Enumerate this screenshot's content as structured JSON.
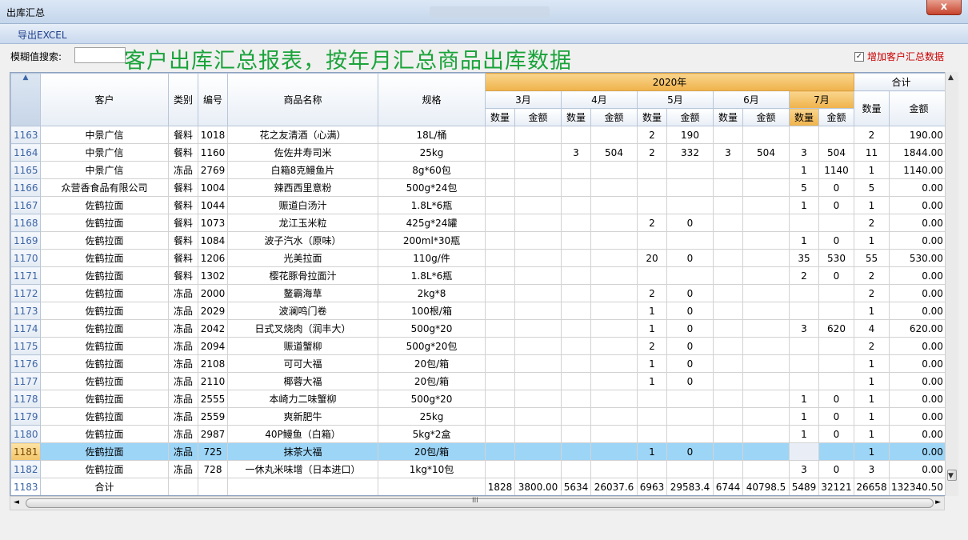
{
  "window": {
    "title": "出库汇总",
    "close_label": "x"
  },
  "toolbar": {
    "export_label": "导出EXCEL"
  },
  "search": {
    "label": "模糊值搜索:",
    "value": ""
  },
  "banner": "客户出库汇总报表，按年月汇总商品出库数据",
  "option": {
    "label": "增加客户汇总数据",
    "checked": "✓"
  },
  "headers": {
    "customer": "客户",
    "category": "类别",
    "code": "编号",
    "product": "商品名称",
    "spec": "规格",
    "year": "2020年",
    "total_group": "合计",
    "months": [
      "3月",
      "4月",
      "5月",
      "6月",
      "7月"
    ],
    "qty": "数量",
    "amt": "金额"
  },
  "rows": [
    {
      "rn": "1163",
      "customer": "中景广信",
      "cat": "餐料",
      "code": "1018",
      "name": "花之友清酒（心满）",
      "spec": "18L/桶",
      "m": [
        [
          "",
          ""
        ],
        [
          "",
          ""
        ],
        [
          "2",
          "190"
        ],
        [
          "",
          ""
        ],
        [
          "",
          ""
        ]
      ],
      "tq": "2",
      "ta": "190.00"
    },
    {
      "rn": "1164",
      "customer": "中景广信",
      "cat": "餐料",
      "code": "1160",
      "name": "佐佐井寿司米",
      "spec": "25kg",
      "m": [
        [
          "",
          ""
        ],
        [
          "3",
          "504"
        ],
        [
          "2",
          "332"
        ],
        [
          "3",
          "504"
        ],
        [
          "3",
          "504"
        ]
      ],
      "tq": "11",
      "ta": "1844.00"
    },
    {
      "rn": "1165",
      "customer": "中景广信",
      "cat": "冻品",
      "code": "2769",
      "name": "白箱8克鳗鱼片",
      "spec": "8g*60包",
      "m": [
        [
          "",
          ""
        ],
        [
          "",
          ""
        ],
        [
          "",
          ""
        ],
        [
          "",
          ""
        ],
        [
          "1",
          "1140"
        ]
      ],
      "tq": "1",
      "ta": "1140.00"
    },
    {
      "rn": "1166",
      "customer": "众营香食品有限公司",
      "cat": "餐料",
      "code": "1004",
      "name": "辣西西里意粉",
      "spec": "500g*24包",
      "m": [
        [
          "",
          ""
        ],
        [
          "",
          ""
        ],
        [
          "",
          ""
        ],
        [
          "",
          ""
        ],
        [
          "5",
          "0"
        ]
      ],
      "tq": "5",
      "ta": "0.00"
    },
    {
      "rn": "1167",
      "customer": "佐鹤拉面",
      "cat": "餐料",
      "code": "1044",
      "name": "赈道白汤汁",
      "spec": "1.8L*6瓶",
      "m": [
        [
          "",
          ""
        ],
        [
          "",
          ""
        ],
        [
          "",
          ""
        ],
        [
          "",
          ""
        ],
        [
          "1",
          "0"
        ]
      ],
      "tq": "1",
      "ta": "0.00"
    },
    {
      "rn": "1168",
      "customer": "佐鹤拉面",
      "cat": "餐料",
      "code": "1073",
      "name": "龙江玉米粒",
      "spec": "425g*24罐",
      "m": [
        [
          "",
          ""
        ],
        [
          "",
          ""
        ],
        [
          "2",
          "0"
        ],
        [
          "",
          ""
        ],
        [
          "",
          ""
        ]
      ],
      "tq": "2",
      "ta": "0.00"
    },
    {
      "rn": "1169",
      "customer": "佐鹤拉面",
      "cat": "餐料",
      "code": "1084",
      "name": "波子汽水（原味）",
      "spec": "200ml*30瓶",
      "m": [
        [
          "",
          ""
        ],
        [
          "",
          ""
        ],
        [
          "",
          ""
        ],
        [
          "",
          ""
        ],
        [
          "1",
          "0"
        ]
      ],
      "tq": "1",
      "ta": "0.00"
    },
    {
      "rn": "1170",
      "customer": "佐鹤拉面",
      "cat": "餐料",
      "code": "1206",
      "name": "光美拉面",
      "spec": "110g/件",
      "m": [
        [
          "",
          ""
        ],
        [
          "",
          ""
        ],
        [
          "20",
          "0"
        ],
        [
          "",
          ""
        ],
        [
          "35",
          "530"
        ]
      ],
      "tq": "55",
      "ta": "530.00"
    },
    {
      "rn": "1171",
      "customer": "佐鹤拉面",
      "cat": "餐料",
      "code": "1302",
      "name": "樱花豚骨拉面汁",
      "spec": "1.8L*6瓶",
      "m": [
        [
          "",
          ""
        ],
        [
          "",
          ""
        ],
        [
          "",
          ""
        ],
        [
          "",
          ""
        ],
        [
          "2",
          "0"
        ]
      ],
      "tq": "2",
      "ta": "0.00"
    },
    {
      "rn": "1172",
      "customer": "佐鹤拉面",
      "cat": "冻品",
      "code": "2000",
      "name": "鳌霸海草",
      "spec": "2kg*8",
      "m": [
        [
          "",
          ""
        ],
        [
          "",
          ""
        ],
        [
          "2",
          "0"
        ],
        [
          "",
          ""
        ],
        [
          "",
          ""
        ]
      ],
      "tq": "2",
      "ta": "0.00"
    },
    {
      "rn": "1173",
      "customer": "佐鹤拉面",
      "cat": "冻品",
      "code": "2029",
      "name": "波澜鸣门卷",
      "spec": "100根/箱",
      "m": [
        [
          "",
          ""
        ],
        [
          "",
          ""
        ],
        [
          "1",
          "0"
        ],
        [
          "",
          ""
        ],
        [
          "",
          ""
        ]
      ],
      "tq": "1",
      "ta": "0.00"
    },
    {
      "rn": "1174",
      "customer": "佐鹤拉面",
      "cat": "冻品",
      "code": "2042",
      "name": "日式叉烧肉（润丰大）",
      "spec": "500g*20",
      "m": [
        [
          "",
          ""
        ],
        [
          "",
          ""
        ],
        [
          "1",
          "0"
        ],
        [
          "",
          ""
        ],
        [
          "3",
          "620"
        ]
      ],
      "tq": "4",
      "ta": "620.00"
    },
    {
      "rn": "1175",
      "customer": "佐鹤拉面",
      "cat": "冻品",
      "code": "2094",
      "name": "赈道蟹柳",
      "spec": "500g*20包",
      "m": [
        [
          "",
          ""
        ],
        [
          "",
          ""
        ],
        [
          "2",
          "0"
        ],
        [
          "",
          ""
        ],
        [
          "",
          ""
        ]
      ],
      "tq": "2",
      "ta": "0.00"
    },
    {
      "rn": "1176",
      "customer": "佐鹤拉面",
      "cat": "冻品",
      "code": "2108",
      "name": "可可大福",
      "spec": "20包/箱",
      "m": [
        [
          "",
          ""
        ],
        [
          "",
          ""
        ],
        [
          "1",
          "0"
        ],
        [
          "",
          ""
        ],
        [
          "",
          ""
        ]
      ],
      "tq": "1",
      "ta": "0.00"
    },
    {
      "rn": "1177",
      "customer": "佐鹤拉面",
      "cat": "冻品",
      "code": "2110",
      "name": "椰蓉大福",
      "spec": "20包/箱",
      "m": [
        [
          "",
          ""
        ],
        [
          "",
          ""
        ],
        [
          "1",
          "0"
        ],
        [
          "",
          ""
        ],
        [
          "",
          ""
        ]
      ],
      "tq": "1",
      "ta": "0.00"
    },
    {
      "rn": "1178",
      "customer": "佐鹤拉面",
      "cat": "冻品",
      "code": "2555",
      "name": "本崎力二味蟹柳",
      "spec": "500g*20",
      "m": [
        [
          "",
          ""
        ],
        [
          "",
          ""
        ],
        [
          "",
          ""
        ],
        [
          "",
          ""
        ],
        [
          "1",
          "0"
        ]
      ],
      "tq": "1",
      "ta": "0.00"
    },
    {
      "rn": "1179",
      "customer": "佐鹤拉面",
      "cat": "冻品",
      "code": "2559",
      "name": "爽新肥牛",
      "spec": "25kg",
      "m": [
        [
          "",
          ""
        ],
        [
          "",
          ""
        ],
        [
          "",
          ""
        ],
        [
          "",
          ""
        ],
        [
          "1",
          "0"
        ]
      ],
      "tq": "1",
      "ta": "0.00"
    },
    {
      "rn": "1180",
      "customer": "佐鹤拉面",
      "cat": "冻品",
      "code": "2987",
      "name": "40P鳗鱼（白箱）",
      "spec": "5kg*2盒",
      "m": [
        [
          "",
          ""
        ],
        [
          "",
          ""
        ],
        [
          "",
          ""
        ],
        [
          "",
          ""
        ],
        [
          "1",
          "0"
        ]
      ],
      "tq": "1",
      "ta": "0.00"
    },
    {
      "rn": "1181",
      "customer": "佐鹤拉面",
      "cat": "冻品",
      "code": "725",
      "name": "抹茶大福",
      "spec": "20包/箱",
      "m": [
        [
          "",
          ""
        ],
        [
          "",
          ""
        ],
        [
          "1",
          "0"
        ],
        [
          "",
          ""
        ],
        [
          "",
          ""
        ]
      ],
      "tq": "1",
      "ta": "0.00",
      "selected": true
    },
    {
      "rn": "1182",
      "customer": "佐鹤拉面",
      "cat": "冻品",
      "code": "728",
      "name": "一休丸米味增（日本进口）",
      "spec": "1kg*10包",
      "m": [
        [
          "",
          ""
        ],
        [
          "",
          ""
        ],
        [
          "",
          ""
        ],
        [
          "",
          ""
        ],
        [
          "3",
          "0"
        ]
      ],
      "tq": "3",
      "ta": "0.00"
    }
  ],
  "total_row": {
    "rn": "1183",
    "label": "合计",
    "m": [
      [
        "1828",
        "3800.00"
      ],
      [
        "5634",
        "26037.6"
      ],
      [
        "6963",
        "29583.4"
      ],
      [
        "6744",
        "40798.5"
      ],
      [
        "5489",
        "32121"
      ]
    ],
    "tq": "26658",
    "ta": "132340.50"
  },
  "scroll": {
    "up": "▲",
    "down": "▼",
    "left": "◄",
    "right": "►",
    "grip": "III"
  }
}
